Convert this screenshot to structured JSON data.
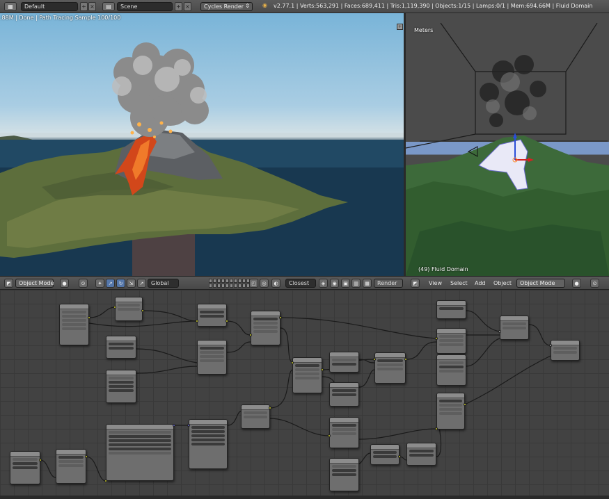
{
  "topbar": {
    "layout_icon": "layout-icon",
    "screen_name": "Default",
    "scene_icon": "scene-icon",
    "scene_name": "Scene",
    "render_engine": "Cycles Render",
    "stats": "v2.77.1 | Verts:563,291 | Faces:689,411 | Tris:1,119,390 | Objects:1/15 | Lamps:0/1 | Mem:694.66M | Fluid Domain"
  },
  "render_view": {
    "status": ".88M | Done | Path Tracing Sample 100/100"
  },
  "solid_view": {
    "units": "Meters",
    "object_label": "(49) Fluid Domain"
  },
  "viewport_header": {
    "mode_left": "Object Mode",
    "orientation": "Global",
    "snap_element": "Closest",
    "render_label": "Render",
    "menus": [
      "View",
      "Select",
      "Add",
      "Object"
    ],
    "mode_right": "Object Mode"
  },
  "node_editor": {
    "node_title": "Node"
  },
  "colors": {
    "socket_color": "#c7c729",
    "node_body": "#6e6e6e",
    "grid_bg": "#424242"
  }
}
